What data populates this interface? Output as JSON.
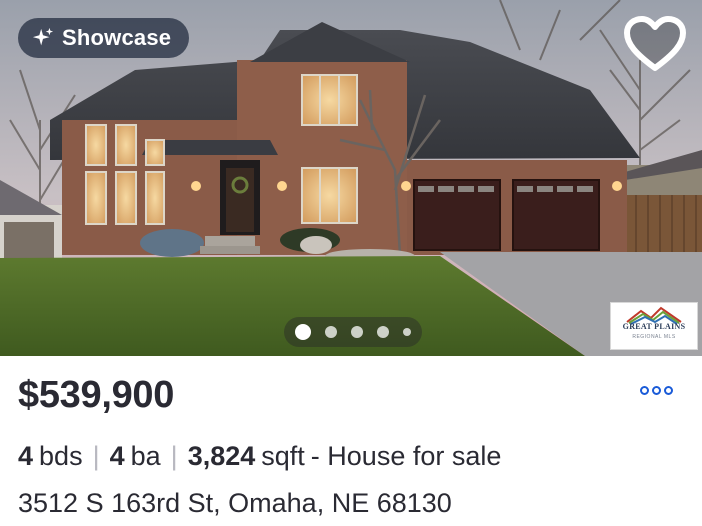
{
  "listing": {
    "badge": {
      "label": "Showcase",
      "icon": "sparkle-icon"
    },
    "favorite_icon": "heart-icon",
    "photo_carousel": {
      "dot_count": 5,
      "active_index": 0
    },
    "mls_logo": {
      "name": "GREAT PLAINS",
      "subtitle": "REGIONAL MLS"
    },
    "price": "$539,900",
    "more_icon": "more-options-icon",
    "beds": {
      "value": "4",
      "unit": "bds"
    },
    "baths": {
      "value": "4",
      "unit": "ba"
    },
    "sqft": {
      "value": "3,824",
      "unit": "sqft"
    },
    "status": "- House for sale",
    "address": "3512 S 163rd St, Omaha, NE 68130"
  },
  "colors": {
    "accent": "#1a5bd8",
    "text": "#2a2a33",
    "badge_bg": "#1e283c"
  }
}
